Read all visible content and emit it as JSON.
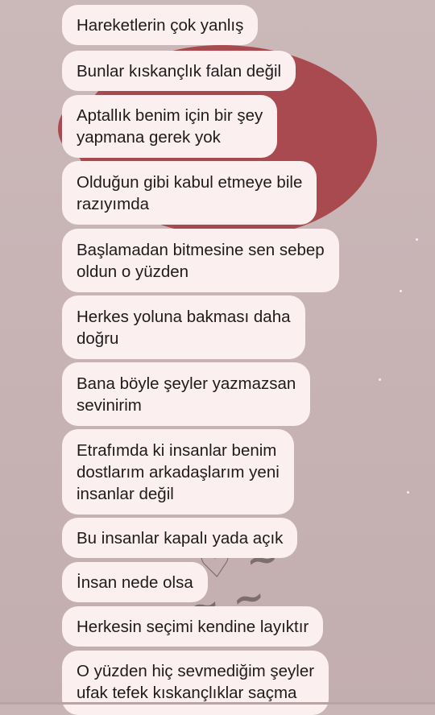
{
  "messages": [
    {
      "text": "Hareketlerin çok yanlış"
    },
    {
      "text": "Bunlar kıskançlık falan değil"
    },
    {
      "text": "Aptallık benim için bir şey\nyapmana gerek yok"
    },
    {
      "text": "Olduğun gibi kabul etmeye bile\nrazıyımda"
    },
    {
      "text": "Başlamadan bitmesine sen sebep\noldun o yüzden"
    },
    {
      "text": "Herkes yoluna bakması daha\ndoğru"
    },
    {
      "text": "Bana böyle şeyler yazmazsan\nsevinirim"
    },
    {
      "text": "Etrafımda ki insanlar benim\ndostlarım arkadaşlarım yeni\ninsanlar değil"
    },
    {
      "text": "Bu insanlar kapalı yada açık"
    },
    {
      "text": "İnsan nede olsa"
    },
    {
      "text": "Herkesin seçimi kendine layıktır"
    },
    {
      "text": "O yüzden hiç sevmediğim şeyler\nufak tefek kıskançlıklar saçma"
    }
  ],
  "theme": {
    "bubble_color": "#fbeff0",
    "wallpaper_color": "#c9b5b6",
    "accent_blob": "#a84a4f"
  }
}
